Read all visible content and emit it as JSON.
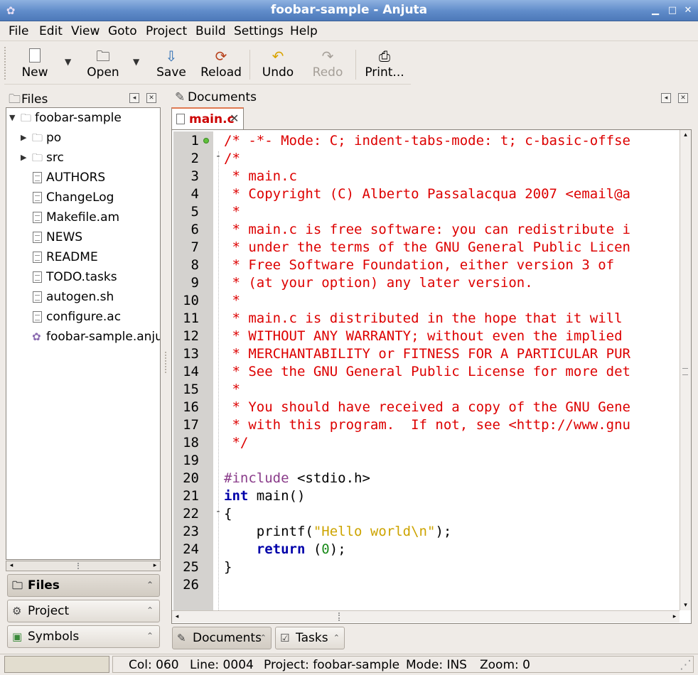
{
  "window": {
    "title": "foobar-sample - Anjuta"
  },
  "menu": [
    "File",
    "Edit",
    "View",
    "Goto",
    "Project",
    "Build",
    "Settings",
    "Help"
  ],
  "toolbar": {
    "new": "New",
    "open": "Open",
    "save": "Save",
    "reload": "Reload",
    "undo": "Undo",
    "redo": "Redo",
    "print": "Print..."
  },
  "files_panel": {
    "title": "Files",
    "tree": [
      {
        "label": "foobar-sample",
        "kind": "folder",
        "expanded": true,
        "depth": 0
      },
      {
        "label": "po",
        "kind": "folder",
        "expanded": false,
        "depth": 1
      },
      {
        "label": "src",
        "kind": "folder",
        "expanded": false,
        "depth": 1
      },
      {
        "label": "AUTHORS",
        "kind": "file",
        "depth": 1
      },
      {
        "label": "ChangeLog",
        "kind": "file",
        "depth": 1
      },
      {
        "label": "Makefile.am",
        "kind": "file",
        "depth": 1
      },
      {
        "label": "NEWS",
        "kind": "file",
        "depth": 1
      },
      {
        "label": "README",
        "kind": "file",
        "depth": 1
      },
      {
        "label": "TODO.tasks",
        "kind": "file",
        "depth": 1
      },
      {
        "label": "autogen.sh",
        "kind": "script",
        "depth": 1
      },
      {
        "label": "configure.ac",
        "kind": "file",
        "depth": 1
      },
      {
        "label": "foobar-sample.anjut",
        "kind": "project",
        "depth": 1
      }
    ]
  },
  "side_buttons": [
    "Files",
    "Project",
    "Symbols"
  ],
  "documents_panel": {
    "title": "Documents",
    "tab_label": "main.c"
  },
  "editor": {
    "lines": [
      {
        "n": "1",
        "fold": "",
        "bp": true,
        "parts": [
          [
            "c-com",
            "/* -*- Mode: C; indent-tabs-mode: t; c-basic-offse"
          ]
        ]
      },
      {
        "n": "2",
        "fold": "-",
        "parts": [
          [
            "c-com",
            "/*"
          ]
        ]
      },
      {
        "n": "3",
        "fold": "",
        "parts": [
          [
            "c-com",
            " * main.c"
          ]
        ]
      },
      {
        "n": "4",
        "fold": "",
        "parts": [
          [
            "c-com",
            " * Copyright (C) Alberto Passalacqua 2007 <email@a"
          ]
        ]
      },
      {
        "n": "5",
        "fold": "",
        "parts": [
          [
            "c-com",
            " *"
          ]
        ]
      },
      {
        "n": "6",
        "fold": "",
        "parts": [
          [
            "c-com",
            " * main.c is free software: you can redistribute i"
          ]
        ]
      },
      {
        "n": "7",
        "fold": "",
        "parts": [
          [
            "c-com",
            " * under the terms of the GNU General Public Licen"
          ]
        ]
      },
      {
        "n": "8",
        "fold": "",
        "parts": [
          [
            "c-com",
            " * Free Software Foundation, either version 3 of"
          ]
        ]
      },
      {
        "n": "9",
        "fold": "",
        "parts": [
          [
            "c-com",
            " * (at your option) any later version."
          ]
        ]
      },
      {
        "n": "10",
        "fold": "",
        "parts": [
          [
            "c-com",
            " *"
          ]
        ]
      },
      {
        "n": "11",
        "fold": "",
        "parts": [
          [
            "c-com",
            " * main.c is distributed in the hope that it will"
          ]
        ]
      },
      {
        "n": "12",
        "fold": "",
        "parts": [
          [
            "c-com",
            " * WITHOUT ANY WARRANTY; without even the implied"
          ]
        ]
      },
      {
        "n": "13",
        "fold": "",
        "parts": [
          [
            "c-com",
            " * MERCHANTABILITY or FITNESS FOR A PARTICULAR PUR"
          ]
        ]
      },
      {
        "n": "14",
        "fold": "",
        "parts": [
          [
            "c-com",
            " * See the GNU General Public License for more det"
          ]
        ]
      },
      {
        "n": "15",
        "fold": "",
        "parts": [
          [
            "c-com",
            " *"
          ]
        ]
      },
      {
        "n": "16",
        "fold": "",
        "parts": [
          [
            "c-com",
            " * You should have received a copy of the GNU Gene"
          ]
        ]
      },
      {
        "n": "17",
        "fold": "",
        "parts": [
          [
            "c-com",
            " * with this program.  If not, see <http://www.gnu"
          ]
        ]
      },
      {
        "n": "18",
        "fold": "",
        "parts": [
          [
            "c-com",
            " */"
          ]
        ]
      },
      {
        "n": "19",
        "fold": "",
        "parts": []
      },
      {
        "n": "20",
        "fold": "",
        "parts": [
          [
            "c-pre",
            "#include"
          ],
          [
            "",
            " <stdio.h>"
          ]
        ]
      },
      {
        "n": "21",
        "fold": "",
        "parts": [
          [
            "c-kw",
            "int"
          ],
          [
            "",
            " main()"
          ]
        ]
      },
      {
        "n": "22",
        "fold": "-",
        "parts": [
          [
            "",
            "{"
          ]
        ]
      },
      {
        "n": "23",
        "fold": "",
        "parts": [
          [
            "",
            "    printf("
          ],
          [
            "c-str",
            "\"Hello world\\n\""
          ],
          [
            "",
            ");"
          ]
        ]
      },
      {
        "n": "24",
        "fold": "",
        "parts": [
          [
            "",
            "    "
          ],
          [
            "c-kw",
            "return"
          ],
          [
            "",
            " ("
          ],
          [
            "c-num",
            "0"
          ],
          [
            "",
            ");"
          ]
        ]
      },
      {
        "n": "25",
        "fold": "",
        "parts": [
          [
            "",
            "}"
          ]
        ]
      },
      {
        "n": "26",
        "fold": "",
        "parts": []
      }
    ]
  },
  "bottom_tabs": [
    "Documents",
    "Tasks"
  ],
  "status": {
    "col": "Col: 060",
    "line": "Line: 0004",
    "project": "Project: foobar-sample",
    "mode": "Mode: INS",
    "zoom": "Zoom: 0"
  }
}
